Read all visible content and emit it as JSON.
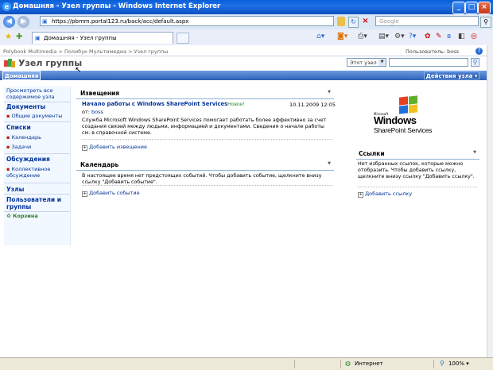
{
  "window": {
    "title": "Домашняя - Узел группы - Windows Internet Explorer"
  },
  "address": {
    "url": "https://pbmm.portal123.ru/back/acc/default.aspx",
    "search_placeholder": "Google"
  },
  "tab": {
    "label": "Домашняя - Узел группы"
  },
  "breadcrumb": "Polybook Multimedia > Полибук Мультимедиа > Узел группы",
  "user": "Пользователь: boss",
  "site": {
    "title": "Узел группы",
    "scope_select": "Этот узел"
  },
  "top_tab": "Домашняя",
  "site_actions": "Действия узла",
  "left_nav": {
    "view_all": "Просмотреть все содержимое узла",
    "documents": "Документы",
    "shared_docs": "Общие документы",
    "lists": "Списки",
    "calendar": "Календарь",
    "tasks": "Задачи",
    "discussions": "Обсуждения",
    "team_discussion": "Коллективное обсуждение",
    "sites": "Узлы",
    "people": "Пользователи и группы",
    "recycle": "Корзина"
  },
  "announcements": {
    "header": "Извещения",
    "item_title": "Начало работы с Windows SharePoint Services",
    "new_badge": "Новое!",
    "date": "10.11.2009 12:05",
    "from_label": "от:",
    "from_user": "boss",
    "body": "Служба Microsoft Windows SharePoint Services помогает работать более эффективно за счет создания связей между людьми, информацией и документами. Сведения о начале работы см. в справочной системе.",
    "add": "Добавить извещение"
  },
  "calendar": {
    "header": "Календарь",
    "body": "В настоящее время нет предстоящих событий. Чтобы добавить событие, щелкните внизу ссылку \"Добавить событие\".",
    "add": "Добавить событие"
  },
  "logo": {
    "line1": "Windows",
    "line2": "SharePoint Services",
    "small": "Microsoft"
  },
  "links": {
    "header": "Ссылки",
    "body": "Нет избранных ссылок, которые можно отобразить. Чтобы добавить ссылку, щелкните внизу ссылку \"Добавить ссылку\".",
    "add": "Добавить ссылку"
  },
  "status": {
    "zone": "Интернет",
    "zoom": "100%"
  }
}
